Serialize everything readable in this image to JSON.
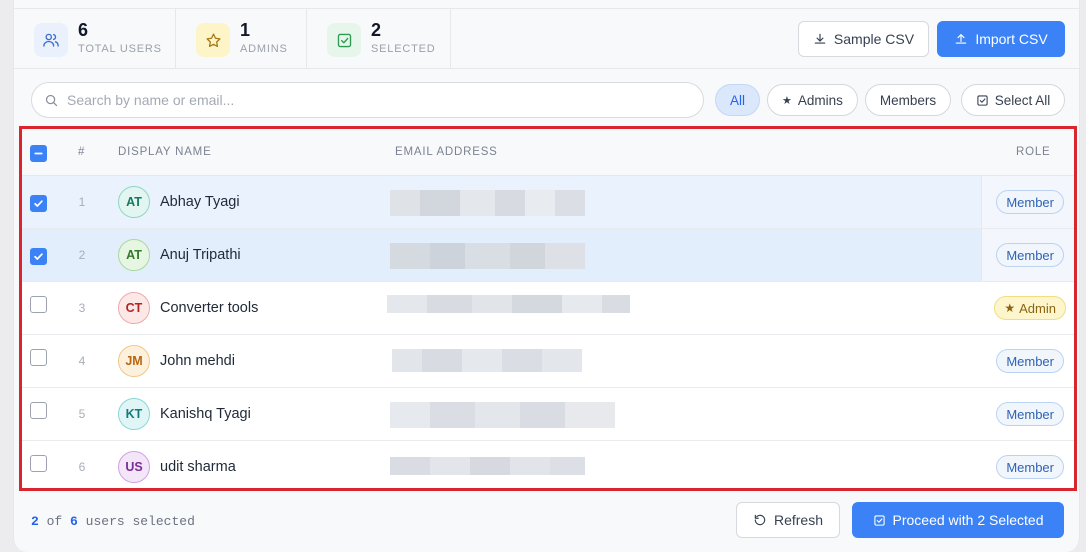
{
  "stats": [
    {
      "value": "6",
      "label": "TOTAL USERS",
      "icon": "users-icon"
    },
    {
      "value": "1",
      "label": "ADMINS",
      "icon": "star-icon"
    },
    {
      "value": "2",
      "label": "SELECTED",
      "icon": "check-square-icon"
    }
  ],
  "toolbar": {
    "sample_csv": "Sample CSV",
    "import_csv": "Import CSV"
  },
  "search": {
    "placeholder": "Search by name or email...",
    "value": ""
  },
  "filters": {
    "all": "All",
    "admins": "Admins",
    "members": "Members",
    "select_all": "Select All",
    "active": "All"
  },
  "table": {
    "headers": {
      "index": "#",
      "display_name": "DISPLAY NAME",
      "email": "EMAIL ADDRESS",
      "role": "ROLE"
    },
    "rows": [
      {
        "index": "1",
        "initials": "AT",
        "name": "Abhay Tyagi",
        "role": "Member",
        "selected": true
      },
      {
        "index": "2",
        "initials": "AT",
        "name": "Anuj Tripathi",
        "role": "Member",
        "selected": true
      },
      {
        "index": "3",
        "initials": "CT",
        "name": "Converter tools",
        "role": "Admin",
        "selected": false
      },
      {
        "index": "4",
        "initials": "JM",
        "name": "John mehdi",
        "role": "Member",
        "selected": false
      },
      {
        "index": "5",
        "initials": "KT",
        "name": "Kanishq Tyagi",
        "role": "Member",
        "selected": false
      },
      {
        "index": "6",
        "initials": "US",
        "name": "udit sharma",
        "role": "Member",
        "selected": false
      }
    ]
  },
  "footer": {
    "selected_count": "2",
    "of_text": "of",
    "total_count": "6",
    "suffix": "users selected",
    "refresh": "Refresh",
    "proceed_prefix": "Proceed with",
    "proceed_count": "2",
    "proceed_suffix": "Selected"
  },
  "colors": {
    "accent": "#3b82f6",
    "highlight_border": "#d9262e",
    "admin_badge": "#fdf6cd",
    "member_badge": "#f1f6fd"
  }
}
